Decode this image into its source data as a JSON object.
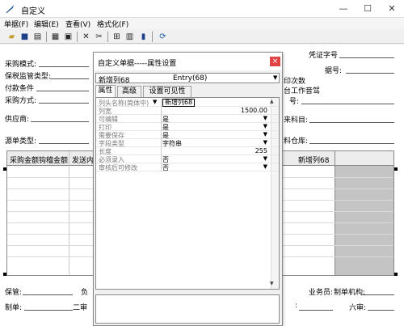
{
  "window": {
    "title": "自定义",
    "minimize": "—",
    "maximize": "☐",
    "close": "✕"
  },
  "menu": [
    "单据(F)",
    "编辑(E)",
    "查看(V)",
    "格式化(F)"
  ],
  "toolbar_icons": [
    "open-icon",
    "save-icon",
    "print-icon",
    "preview-icon",
    "grid-icon",
    "copy-icon",
    "cut-icon",
    "delete-icon",
    "table-icon",
    "columns-icon",
    "lock-icon",
    "refresh-icon"
  ],
  "form": {
    "procurement_mode": "采购模式:",
    "tax_type": "保税监管类型:",
    "payment_terms": "付款条件",
    "procurement_method": "采购方式:",
    "supplier": "供应商:",
    "source_type": "源单类型:",
    "voucher_no": "凭证字号",
    "doc_no_suffix": "据号:",
    "print_count": "印次数",
    "partial_dept": "台工作音驾",
    "partial_no": "号:",
    "partial_subject": "来科目:",
    "partial_warehouse": "料仓库:",
    "keeper": "保管:",
    "partial_owner": "负",
    "maker": "制单:",
    "partial_maker2": "二审",
    "salesman": "业务员:",
    "maker_org": "制单机构:",
    "partial_six": "六审:",
    "colon": ":"
  },
  "grid": {
    "headers": [
      "采购金额钩稽金额",
      "发送内",
      "新增列68"
    ]
  },
  "dialog": {
    "title": "自定义单据-----属性设置",
    "close": "×",
    "combo_left": "新增列68",
    "combo_right": "Entry(68)",
    "tabs": [
      "属性",
      "高级",
      "设置可见性"
    ],
    "properties": [
      {
        "name": "列头名称(简体中)",
        "value": "新增列68",
        "dropdown": false,
        "highlight": true
      },
      {
        "name": "列宽",
        "value": "1500.00",
        "dropdown": false,
        "align": "right"
      },
      {
        "name": "可编辑",
        "value": "是",
        "dropdown": true
      },
      {
        "name": "打印",
        "value": "是",
        "dropdown": true
      },
      {
        "name": "需要保存",
        "value": "是",
        "dropdown": true
      },
      {
        "name": "字段类型",
        "value": "字符串",
        "dropdown": true
      },
      {
        "name": "长度",
        "value": "255",
        "dropdown": false,
        "align": "right"
      },
      {
        "name": "必须录入",
        "value": "否",
        "dropdown": true
      },
      {
        "name": "审核后可修改",
        "value": "否",
        "dropdown": true
      }
    ]
  }
}
